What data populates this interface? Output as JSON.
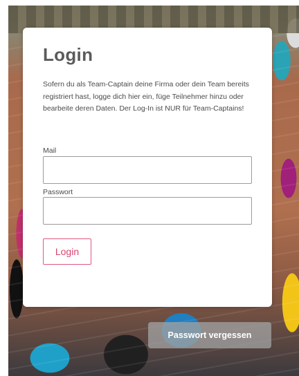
{
  "login": {
    "title": "Login",
    "intro": "Sofern du als Team-Captain deine Firma oder dein Team bereits registriert hast, logge dich hier ein, füge Teilnehmer hinzu oder bearbeite deren Daten. Der Log-In ist NUR für Team-Captains!",
    "mail_label": "Mail",
    "mail_value": "",
    "password_label": "Passwort",
    "password_value": "",
    "login_button": "Login"
  },
  "forgot_password_button": "Passwort vergessen",
  "colors": {
    "accent": "#d9456f",
    "title": "#5b5b5b",
    "forgot_button_bg": "#a0a0a0"
  }
}
